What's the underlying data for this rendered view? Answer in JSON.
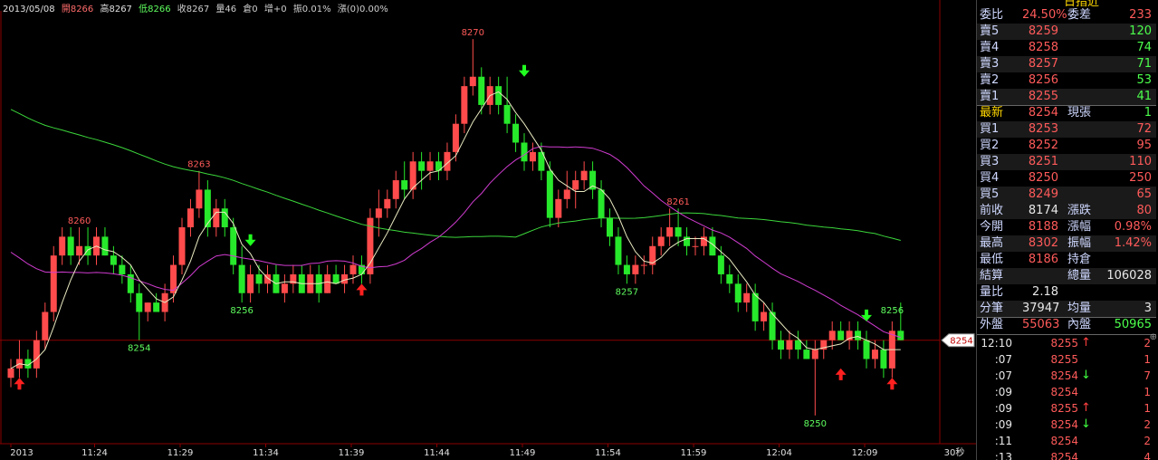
{
  "header": {
    "date": "2013/05/08",
    "open": "開8266",
    "high": "高8267",
    "low": "低8266",
    "close": "收8267",
    "volume": "量46",
    "oi": "倉0",
    "oi_change": "增+0",
    "amplitude": "振0.01%",
    "change": "漲(0)0.00%"
  },
  "colors": {
    "up": "#ff4b4b",
    "down": "#27e82b",
    "ma5": "#e8e8c0",
    "ma20": "#d03cd0",
    "ma60": "#3bd63b",
    "grid": "#8b0000"
  },
  "chart_data": {
    "type": "candlestick",
    "x_tick_labels": [
      "2013",
      "11:24",
      "11:29",
      "11:34",
      "11:39",
      "11:44",
      "11:49",
      "11:54",
      "11:59",
      "12:04",
      "12:09"
    ],
    "x_unit_label": "30秒",
    "ylim": [
      8248.5,
      8271.5
    ],
    "current_price_marker": "8254",
    "annotations": [
      {
        "label": "8260",
        "index": 8,
        "value": 8260
      },
      {
        "label": "8263",
        "index": 22,
        "value": 8263
      },
      {
        "label": "8256",
        "index": 27,
        "value": 8256
      },
      {
        "label": "8254",
        "index": 15,
        "value": 8254
      },
      {
        "label": "8270",
        "index": 54,
        "value": 8270
      },
      {
        "label": "8257",
        "index": 72,
        "value": 8257
      },
      {
        "label": "8261",
        "index": 78,
        "value": 8261
      },
      {
        "label": "8250",
        "index": 94,
        "value": 8250
      },
      {
        "label": "8256",
        "index": 103,
        "value": 8256
      }
    ],
    "signals": [
      {
        "index": 1,
        "type": "buy",
        "value": 8252
      },
      {
        "index": 28,
        "type": "sell",
        "value": 8259
      },
      {
        "index": 41,
        "type": "buy",
        "value": 8257
      },
      {
        "index": 60,
        "type": "sell",
        "value": 8268
      },
      {
        "index": 97,
        "type": "buy",
        "value": 8252.5
      },
      {
        "index": 100,
        "type": "sell",
        "value": 8255
      },
      {
        "index": 103,
        "type": "buy",
        "value": 8252
      }
    ],
    "candles": [
      [
        8252,
        8253,
        8251.5,
        8252.5
      ],
      [
        8252.5,
        8254,
        8252,
        8253
      ],
      [
        8253,
        8253.5,
        8252,
        8252.5
      ],
      [
        8252.5,
        8254.5,
        8252,
        8254
      ],
      [
        8254,
        8256,
        8253.5,
        8255.5
      ],
      [
        8255.5,
        8259,
        8255,
        8258.5
      ],
      [
        8258.5,
        8260,
        8258,
        8259.5
      ],
      [
        8259.5,
        8260,
        8258,
        8258.5
      ],
      [
        8258.5,
        8260,
        8258,
        8259
      ],
      [
        8259,
        8260,
        8258,
        8258.5
      ],
      [
        8258.5,
        8260,
        8258,
        8259.5
      ],
      [
        8259.5,
        8260,
        8258.5,
        8258.5
      ],
      [
        8258.5,
        8259,
        8257.5,
        8258
      ],
      [
        8258,
        8258.5,
        8257,
        8257.5
      ],
      [
        8257.5,
        8258,
        8256,
        8256.5
      ],
      [
        8256.5,
        8257,
        8254,
        8255.5
      ],
      [
        8255.5,
        8256,
        8255,
        8256
      ],
      [
        8256,
        8256.5,
        8255.5,
        8255.5
      ],
      [
        8255.5,
        8257,
        8255,
        8256.5
      ],
      [
        8256.5,
        8258.5,
        8256,
        8258
      ],
      [
        8258,
        8260.5,
        8257.5,
        8260
      ],
      [
        8260,
        8261.5,
        8259.5,
        8261
      ],
      [
        8261,
        8263,
        8260.5,
        8262
      ],
      [
        8262,
        8262.5,
        8259.5,
        8260
      ],
      [
        8260,
        8261.5,
        8259.5,
        8261
      ],
      [
        8261,
        8261.5,
        8259.5,
        8260
      ],
      [
        8260,
        8260.5,
        8257.5,
        8258
      ],
      [
        8258,
        8259,
        8256,
        8256.5
      ],
      [
        8256.5,
        8258,
        8256,
        8257.5
      ],
      [
        8257.5,
        8258,
        8256.5,
        8257
      ],
      [
        8257,
        8258,
        8256.5,
        8257.5
      ],
      [
        8257.5,
        8258,
        8256.5,
        8256.5
      ],
      [
        8256.5,
        8257.5,
        8256,
        8257
      ],
      [
        8257,
        8258,
        8256.5,
        8257.5
      ],
      [
        8257.5,
        8258,
        8256.5,
        8256.5
      ],
      [
        8256.5,
        8258,
        8256.5,
        8257.5
      ],
      [
        8257.5,
        8258,
        8256,
        8256.5
      ],
      [
        8256.5,
        8258,
        8256.5,
        8257.5
      ],
      [
        8257.5,
        8258,
        8257,
        8257
      ],
      [
        8257,
        8258,
        8256.5,
        8257.5
      ],
      [
        8257.5,
        8258.5,
        8257,
        8258
      ],
      [
        8258,
        8258.5,
        8257,
        8257.5
      ],
      [
        8257.5,
        8261,
        8257,
        8260.5
      ],
      [
        8260.5,
        8262,
        8259.5,
        8261
      ],
      [
        8261,
        8262,
        8260.5,
        8261.5
      ],
      [
        8261.5,
        8263,
        8261,
        8262.5
      ],
      [
        8262.5,
        8263.5,
        8261.5,
        8262
      ],
      [
        8262,
        8264,
        8261.5,
        8263.5
      ],
      [
        8263.5,
        8264,
        8262,
        8263
      ],
      [
        8263,
        8264,
        8262.5,
        8263.5
      ],
      [
        8263.5,
        8264,
        8262.5,
        8263
      ],
      [
        8263,
        8264.5,
        8262.5,
        8264
      ],
      [
        8264,
        8266,
        8263.5,
        8265.5
      ],
      [
        8265.5,
        8268,
        8265,
        8267.5
      ],
      [
        8267.5,
        8270,
        8267,
        8268
      ],
      [
        8268,
        8268.5,
        8266,
        8266.5
      ],
      [
        8266.5,
        8268,
        8266,
        8267.5
      ],
      [
        8267.5,
        8268,
        8266,
        8266.5
      ],
      [
        8266.5,
        8268,
        8265,
        8265.5
      ],
      [
        8265.5,
        8266,
        8264,
        8264.5
      ],
      [
        8264.5,
        8265,
        8263,
        8263.5
      ],
      [
        8263.5,
        8264.5,
        8263,
        8264
      ],
      [
        8264,
        8264.5,
        8262.5,
        8263
      ],
      [
        8263,
        8263.5,
        8260,
        8260.5
      ],
      [
        8260.5,
        8262,
        8260,
        8261.5
      ],
      [
        8261.5,
        8263,
        8261,
        8262
      ],
      [
        8262,
        8263,
        8261,
        8262.5
      ],
      [
        8262.5,
        8263.5,
        8262,
        8263
      ],
      [
        8263,
        8263.5,
        8261.5,
        8262
      ],
      [
        8262,
        8262.5,
        8260,
        8260.5
      ],
      [
        8260.5,
        8261,
        8259,
        8259.5
      ],
      [
        8259.5,
        8260,
        8257.5,
        8258
      ],
      [
        8258,
        8258.5,
        8257,
        8257.5
      ],
      [
        8257.5,
        8258.5,
        8257,
        8258
      ],
      [
        8258,
        8258.5,
        8257.5,
        8258
      ],
      [
        8258,
        8259.5,
        8257.5,
        8259
      ],
      [
        8259,
        8260,
        8258.5,
        8259.5
      ],
      [
        8259.5,
        8261,
        8259,
        8260
      ],
      [
        8260,
        8261,
        8259,
        8259.5
      ],
      [
        8259.5,
        8260,
        8258.5,
        8259
      ],
      [
        8259,
        8259.5,
        8258.5,
        8259
      ],
      [
        8259,
        8260,
        8258.5,
        8259.5
      ],
      [
        8259.5,
        8260,
        8258.5,
        8258.5
      ],
      [
        8258.5,
        8259,
        8257,
        8257.5
      ],
      [
        8257.5,
        8258,
        8256.5,
        8257
      ],
      [
        8257,
        8257.5,
        8255.5,
        8256
      ],
      [
        8256,
        8257,
        8255.5,
        8256.5
      ],
      [
        8256.5,
        8257,
        8254.5,
        8255
      ],
      [
        8255,
        8256,
        8254.5,
        8255.5
      ],
      [
        8255.5,
        8256,
        8253.5,
        8254
      ],
      [
        8254,
        8254.5,
        8253,
        8253.5
      ],
      [
        8253.5,
        8254.5,
        8253,
        8254
      ],
      [
        8254,
        8254.5,
        8253,
        8253.5
      ],
      [
        8253.5,
        8254,
        8253,
        8253
      ],
      [
        8253,
        8254,
        8250,
        8253.5
      ],
      [
        8253.5,
        8254,
        8253,
        8254
      ],
      [
        8254,
        8255,
        8253.5,
        8254.5
      ],
      [
        8254.5,
        8255,
        8254,
        8254
      ],
      [
        8254,
        8255,
        8253.5,
        8254.5
      ],
      [
        8254.5,
        8255,
        8253.5,
        8254
      ],
      [
        8254,
        8254.5,
        8252.5,
        8253
      ],
      [
        8253,
        8254,
        8252.5,
        8253.5
      ],
      [
        8253.5,
        8254,
        8252,
        8252.5
      ],
      [
        8252.5,
        8255,
        8252,
        8254.5
      ],
      [
        8254.5,
        8256,
        8254,
        8254
      ]
    ]
  },
  "panel": {
    "header_cut": "日指近",
    "ratio": {
      "label": "委比",
      "value": "24.50%",
      "label2": "委差",
      "value2": "233"
    },
    "asks": [
      {
        "label": "賣5",
        "price": "8259",
        "qty": "120"
      },
      {
        "label": "賣4",
        "price": "8258",
        "qty": "74"
      },
      {
        "label": "賣3",
        "price": "8257",
        "qty": "71"
      },
      {
        "label": "賣2",
        "price": "8256",
        "qty": "53"
      },
      {
        "label": "賣1",
        "price": "8255",
        "qty": "41"
      }
    ],
    "last": {
      "label": "最新",
      "price": "8254",
      "label2": "現張",
      "qty": "1"
    },
    "bids": [
      {
        "label": "買1",
        "price": "8253",
        "qty": "72"
      },
      {
        "label": "買2",
        "price": "8252",
        "qty": "95"
      },
      {
        "label": "買3",
        "price": "8251",
        "qty": "110"
      },
      {
        "label": "買4",
        "price": "8250",
        "qty": "250"
      },
      {
        "label": "買5",
        "price": "8249",
        "qty": "65"
      }
    ],
    "stats": [
      {
        "l1": "前收",
        "v1": "8174",
        "l2": "漲跌",
        "v2": "80"
      },
      {
        "l1": "今開",
        "v1": "8188",
        "l2": "漲幅",
        "v2": "0.98%"
      },
      {
        "l1": "最高",
        "v1": "8302",
        "l2": "振幅",
        "v2": "1.42%"
      },
      {
        "l1": "最低",
        "v1": "8186",
        "l2": "持倉",
        "v2": ""
      },
      {
        "l1": "結算",
        "v1": "",
        "l2": "總量",
        "v2": "106028"
      },
      {
        "l1": "量比",
        "v1": "2.18",
        "l2": "",
        "v2": ""
      },
      {
        "l1": "分筆",
        "v1": "37947",
        "l2": "均量",
        "v2": "3"
      }
    ],
    "outer": {
      "label": "外盤",
      "value": "55063",
      "label2": "內盤",
      "value2": "50965"
    },
    "ticks": [
      {
        "time": "12:10",
        "price": "8255",
        "dir": "up",
        "vol": "2"
      },
      {
        "time": ":07",
        "price": "8255",
        "dir": "",
        "vol": "1"
      },
      {
        "time": ":07",
        "price": "8254",
        "dir": "down",
        "vol": "7"
      },
      {
        "time": ":09",
        "price": "8254",
        "dir": "",
        "vol": "1"
      },
      {
        "time": ":09",
        "price": "8255",
        "dir": "up",
        "vol": "1"
      },
      {
        "time": ":09",
        "price": "8254",
        "dir": "down",
        "vol": "2"
      },
      {
        "time": ":11",
        "price": "8254",
        "dir": "",
        "vol": "2"
      },
      {
        "time": ":13",
        "price": "8254",
        "dir": "",
        "vol": "4"
      }
    ]
  }
}
